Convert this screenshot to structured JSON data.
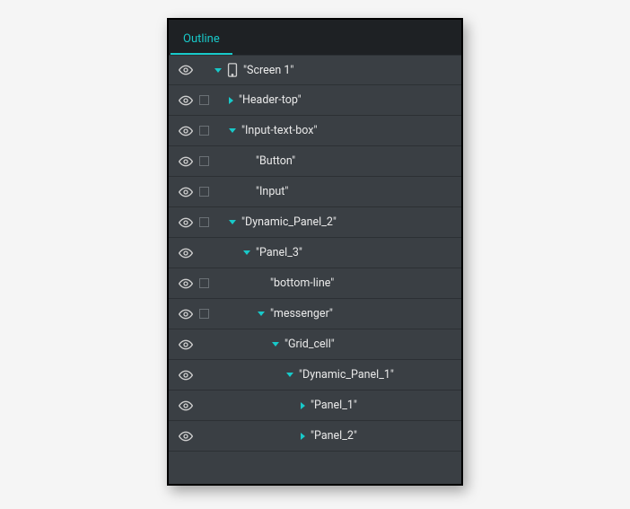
{
  "header": {
    "tab_label": "Outline"
  },
  "colors": {
    "accent": "#18c9c9",
    "panel_bg": "#3a3f44",
    "header_bg": "#1e2124"
  },
  "rows": [
    {
      "id": "screen-1",
      "label": "Screen 1",
      "depth": 0,
      "caret": "expanded",
      "checkbox": false,
      "device_icon": true
    },
    {
      "id": "header-top",
      "label": "Header-top",
      "depth": 1,
      "caret": "collapsed",
      "checkbox": true,
      "device_icon": false
    },
    {
      "id": "input-text-box",
      "label": "Input-text-box",
      "depth": 1,
      "caret": "expanded",
      "checkbox": true,
      "device_icon": false
    },
    {
      "id": "button",
      "label": "Button",
      "depth": 2,
      "caret": "none",
      "checkbox": true,
      "device_icon": false
    },
    {
      "id": "input",
      "label": "Input",
      "depth": 2,
      "caret": "none",
      "checkbox": true,
      "device_icon": false
    },
    {
      "id": "dynamic-panel-2",
      "label": "Dynamic_Panel_2",
      "depth": 1,
      "caret": "expanded",
      "checkbox": true,
      "device_icon": false
    },
    {
      "id": "panel-3",
      "label": "Panel_3",
      "depth": 2,
      "caret": "expanded",
      "checkbox": false,
      "device_icon": false
    },
    {
      "id": "bottom-line",
      "label": "bottom-line",
      "depth": 3,
      "caret": "none",
      "checkbox": true,
      "device_icon": false
    },
    {
      "id": "messenger",
      "label": "messenger",
      "depth": 3,
      "caret": "expanded",
      "checkbox": true,
      "device_icon": false
    },
    {
      "id": "grid-cell",
      "label": "Grid_cell",
      "depth": 4,
      "caret": "expanded",
      "checkbox": false,
      "device_icon": false
    },
    {
      "id": "dynamic-panel-1",
      "label": "Dynamic_Panel_1",
      "depth": 5,
      "caret": "expanded",
      "checkbox": false,
      "device_icon": false
    },
    {
      "id": "panel-1",
      "label": "Panel_1",
      "depth": 6,
      "caret": "collapsed",
      "checkbox": false,
      "device_icon": false
    },
    {
      "id": "panel-2",
      "label": "Panel_2",
      "depth": 6,
      "caret": "collapsed",
      "checkbox": false,
      "device_icon": false
    }
  ]
}
